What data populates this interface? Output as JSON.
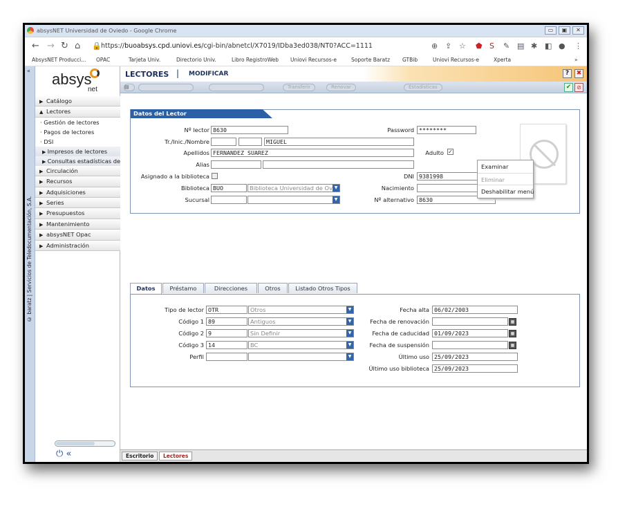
{
  "browser": {
    "title": "absysNET Universidad de Oviedo - Google Chrome",
    "url_prefix": "https://",
    "url_host": "buoabsys.cpd.uniovi.es",
    "url_path": "/cgi-bin/abnetcl/X7019/IDba3ed038/NT0?ACC=1111",
    "bookmarks": [
      "AbsysNET Producci...",
      "OPAC",
      "Tarjeta Univ.",
      "Directorio Univ.",
      "Libro RegistroWeb",
      "Uniovi Recursos-e",
      "Soporte Baratz",
      "GTBib",
      "Uniovi Recursos-e",
      "Xperta"
    ],
    "bookmarks_more": "»"
  },
  "sidebar": {
    "logo": "absys",
    "logo_sub": "net",
    "vertical_text": "© baratz | Servicios de Teledocumentación, S.A.",
    "menu": [
      {
        "label": "Catálogo",
        "arrow": "▶"
      },
      {
        "label": "Lectores",
        "arrow": "▲"
      }
    ],
    "lectores_sub": [
      "Gestión de lectores",
      "Pagos de lectores",
      "DSI"
    ],
    "dsi_sub": [
      "Impresos de lectores",
      "Consultas estadísticas de lectores"
    ],
    "menu_rest": [
      "Circulación",
      "Recursos",
      "Adquisiciones",
      "Series",
      "Presupuestos",
      "Mantenimiento",
      "absysNET Opac",
      "Administración"
    ]
  },
  "header": {
    "module": "LECTORES",
    "separator": "|",
    "mode": "MODIFICAR",
    "help": "?",
    "close": "✖"
  },
  "toolbar": {
    "buttons": [
      "Transferir",
      "Renovar",
      "Estadísticas"
    ]
  },
  "lector": {
    "panel_title": "Datos del Lector",
    "labels": {
      "numero": "Nº lector",
      "tratamiento": "Tr./Inic./Nombre",
      "apellidos": "Apellidos",
      "alias": "Alias",
      "asignado": "Asignado a la biblioteca",
      "biblioteca": "Biblioteca",
      "sucursal": "Sucursal",
      "password": "Password",
      "adulto": "Adulto",
      "dni": "DNI",
      "nacimiento": "Nacimiento",
      "alternativo": "Nº alternativo"
    },
    "values": {
      "numero": "8630",
      "nombre": "MIGUEL",
      "apellidos": "FERNANDEZ SUAREZ",
      "biblioteca_code": "BUO",
      "biblioteca_name": "Biblioteca Universidad de Oviedo",
      "password": "********",
      "adulto_check": "✓",
      "dni": "9381998",
      "alternativo": "8630"
    }
  },
  "context_menu": [
    "Examinar",
    "Eliminar",
    "Deshabilitar menú"
  ],
  "tabs": [
    "Datos",
    "Préstamo",
    "Direcciones",
    "Otros",
    "Listado Otros Tipos"
  ],
  "datos": {
    "labels": {
      "tipo": "Tipo de lector",
      "c1": "Código 1",
      "c2": "Código 2",
      "c3": "Código 3",
      "perfil": "Perfil",
      "alta": "Fecha alta",
      "renov": "Fecha de renovación",
      "cad": "Fecha de caducidad",
      "susp": "Fecha de suspensión",
      "uso": "Último uso",
      "usobib": "Último uso biblioteca"
    },
    "values": {
      "tipo_code": "OTR",
      "tipo_name": "Otros",
      "c1_code": "89",
      "c1_name": "Antiguos",
      "c2_code": "9",
      "c2_name": "Sin Definir",
      "c3_code": "14",
      "c3_name": "BC",
      "alta": "06/02/2003",
      "cad": "01/09/2023",
      "uso": "25/09/2023",
      "usobib": "25/09/2023"
    }
  },
  "bottom_tabs": [
    "Escritorio",
    "Lectores"
  ]
}
